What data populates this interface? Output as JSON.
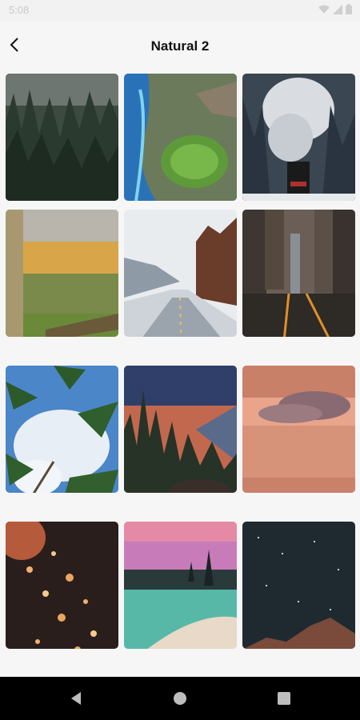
{
  "status_bar": {
    "time": "5:08"
  },
  "header": {
    "title": "Natural 2",
    "back_icon": "chevron-left-icon"
  },
  "gallery": {
    "images": [
      {
        "name": "forest"
      },
      {
        "name": "coast-aerial"
      },
      {
        "name": "train-smoke"
      },
      {
        "name": "field-sunset"
      },
      {
        "name": "snowy-road"
      },
      {
        "name": "city-rain"
      },
      {
        "name": "palm-sky"
      },
      {
        "name": "pine-sunset"
      },
      {
        "name": "sea-sunset"
      },
      {
        "name": "bokeh-lights"
      },
      {
        "name": "beach-palms"
      },
      {
        "name": "starry-mountain"
      }
    ]
  },
  "nav_bar": {
    "icons": [
      "back-triangle-icon",
      "home-circle-icon",
      "recents-square-icon"
    ]
  }
}
